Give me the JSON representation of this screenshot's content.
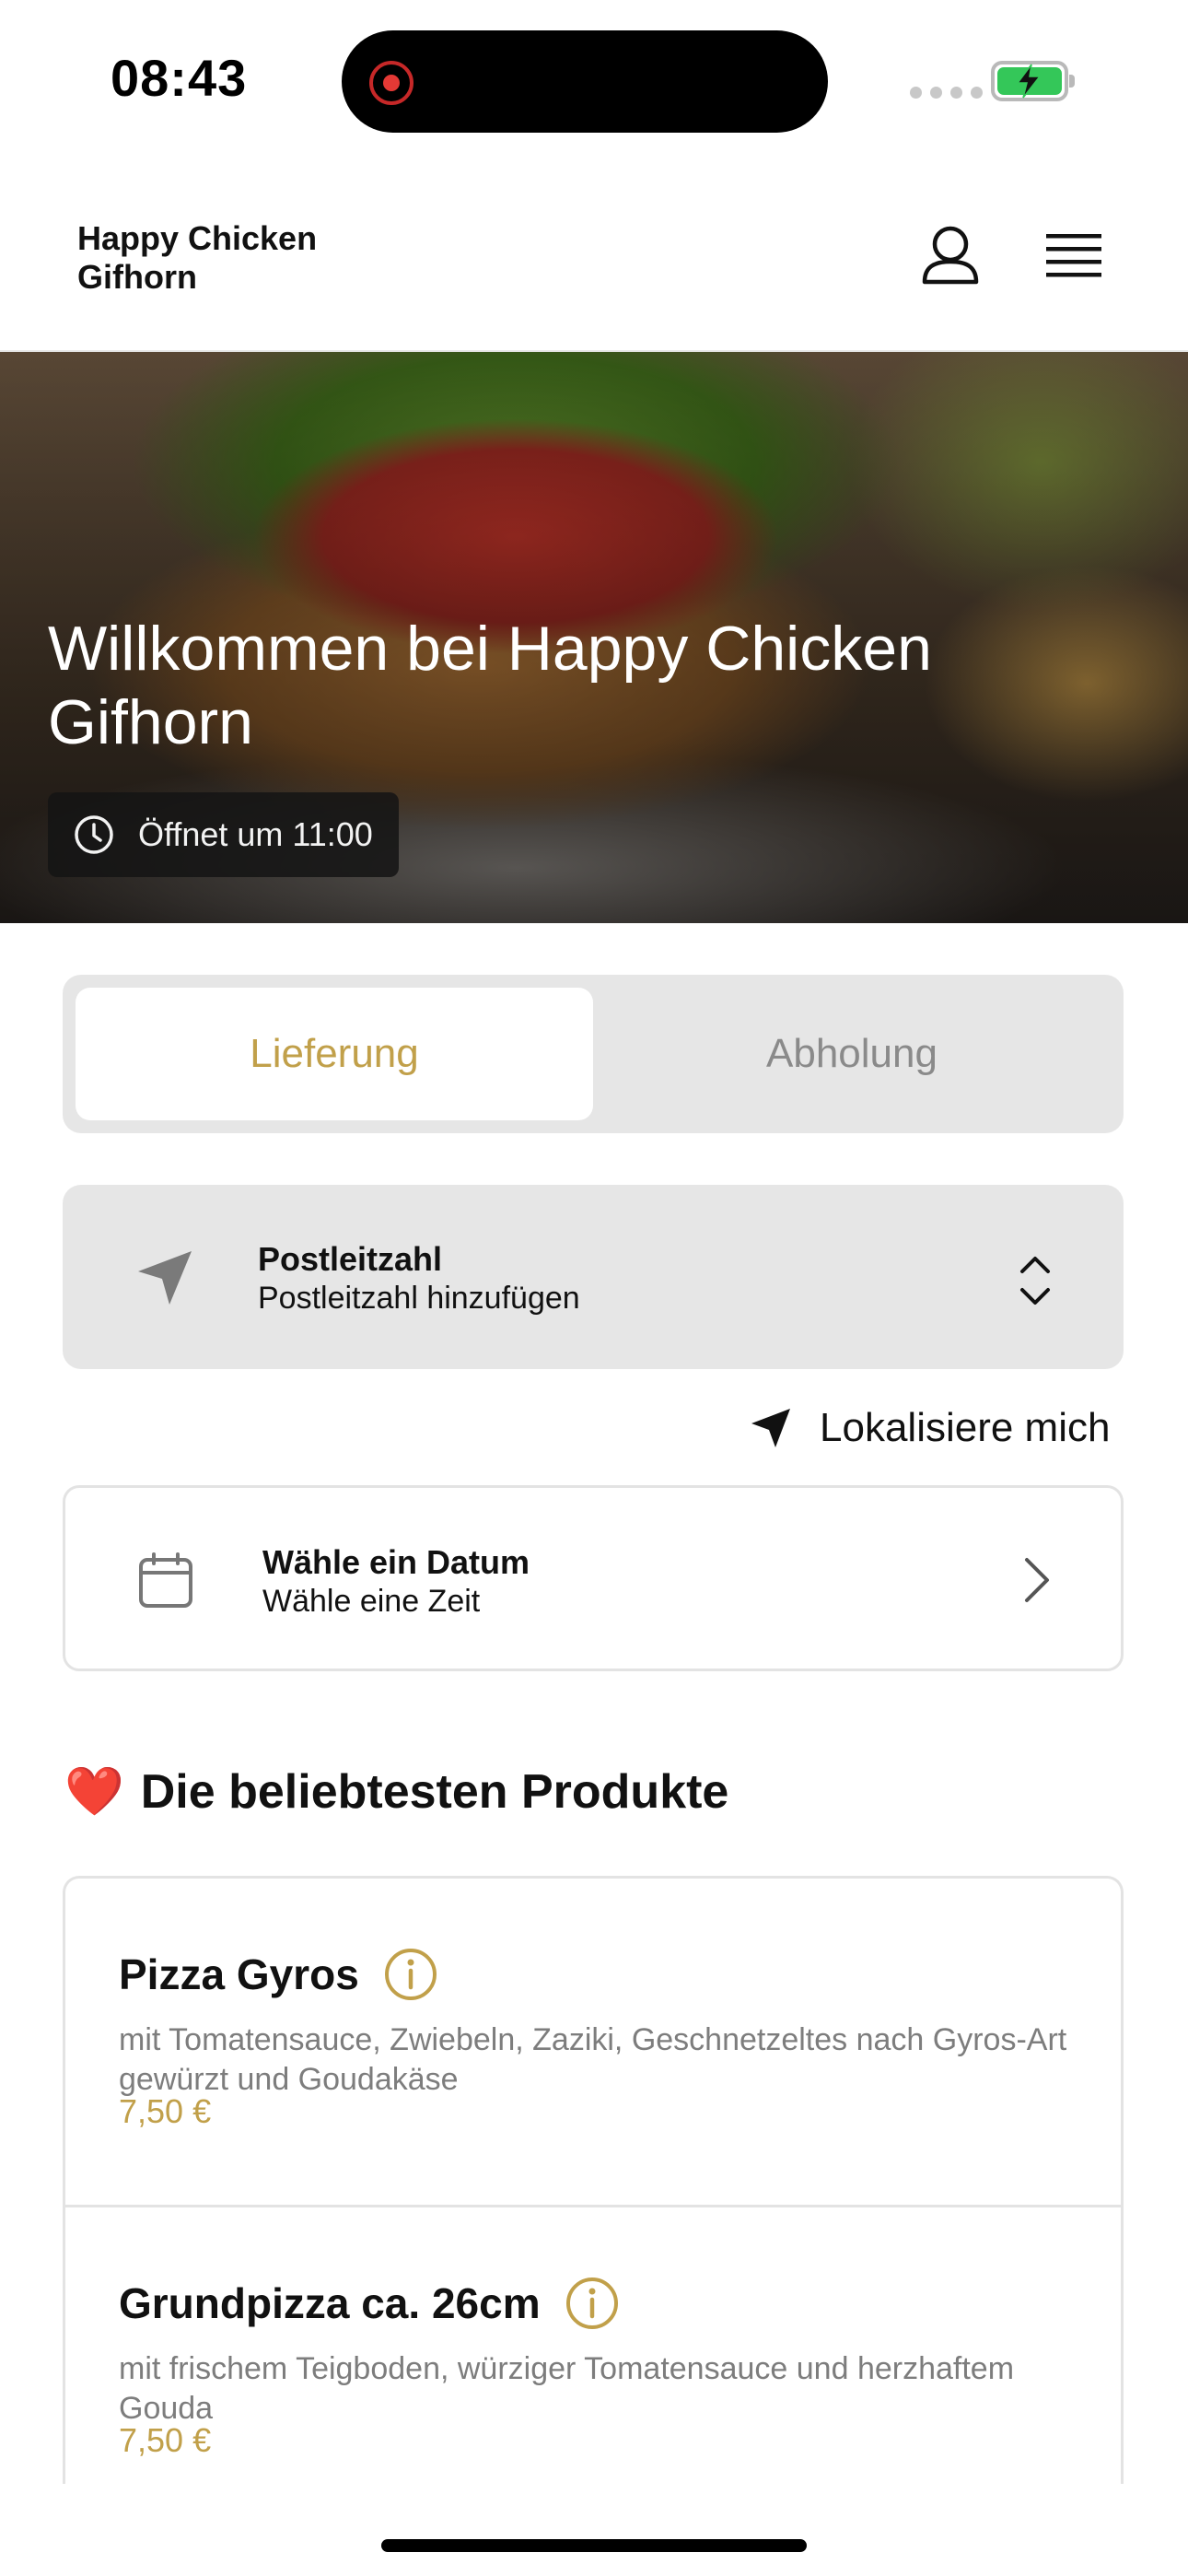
{
  "status_bar": {
    "time": "08:43"
  },
  "header": {
    "brand_line1": "Happy Chicken",
    "brand_line2": "Gifhorn",
    "user_icon": "user-icon",
    "menu_icon": "hamburger-menu-icon"
  },
  "hero": {
    "title": "Willkommen bei Happy Chicken Gifhorn",
    "open_badge": "Öffnet um 11:00",
    "badge_icon": "clock-icon"
  },
  "order_mode": {
    "options": [
      "Lieferung",
      "Abholung"
    ],
    "selected": "Lieferung"
  },
  "postcode": {
    "title": "Postleitzahl",
    "subtitle": "Postleitzahl hinzufügen",
    "icon": "navigation-arrow-icon",
    "toggle_icon": "chevron-up-down-icon"
  },
  "locate": {
    "label": "Lokalisiere mich",
    "icon": "location-arrow-icon"
  },
  "date": {
    "title": "Wähle ein Datum",
    "subtitle": "Wähle eine Zeit",
    "icon": "calendar-icon",
    "chevron": "chevron-right-icon"
  },
  "popular": {
    "emoji": "❤️",
    "title": "Die beliebtesten Produkte",
    "products": [
      {
        "name": "Pizza Gyros",
        "description": "mit Tomatensauce, Zwiebeln, Zaziki, Geschnetzeltes nach Gyros-Art gewürzt und Goudakäse",
        "price": "7,50 €"
      },
      {
        "name": "Grundpizza ca. 26cm",
        "description": "mit frischem Teigboden, würziger Tomatensauce und herzhaftem Gouda",
        "price": "7,50 €"
      }
    ]
  },
  "colors": {
    "accent": "#c1a04a",
    "panel": "#e6e6e6",
    "battery": "#34c759",
    "recording": "#e53935"
  }
}
